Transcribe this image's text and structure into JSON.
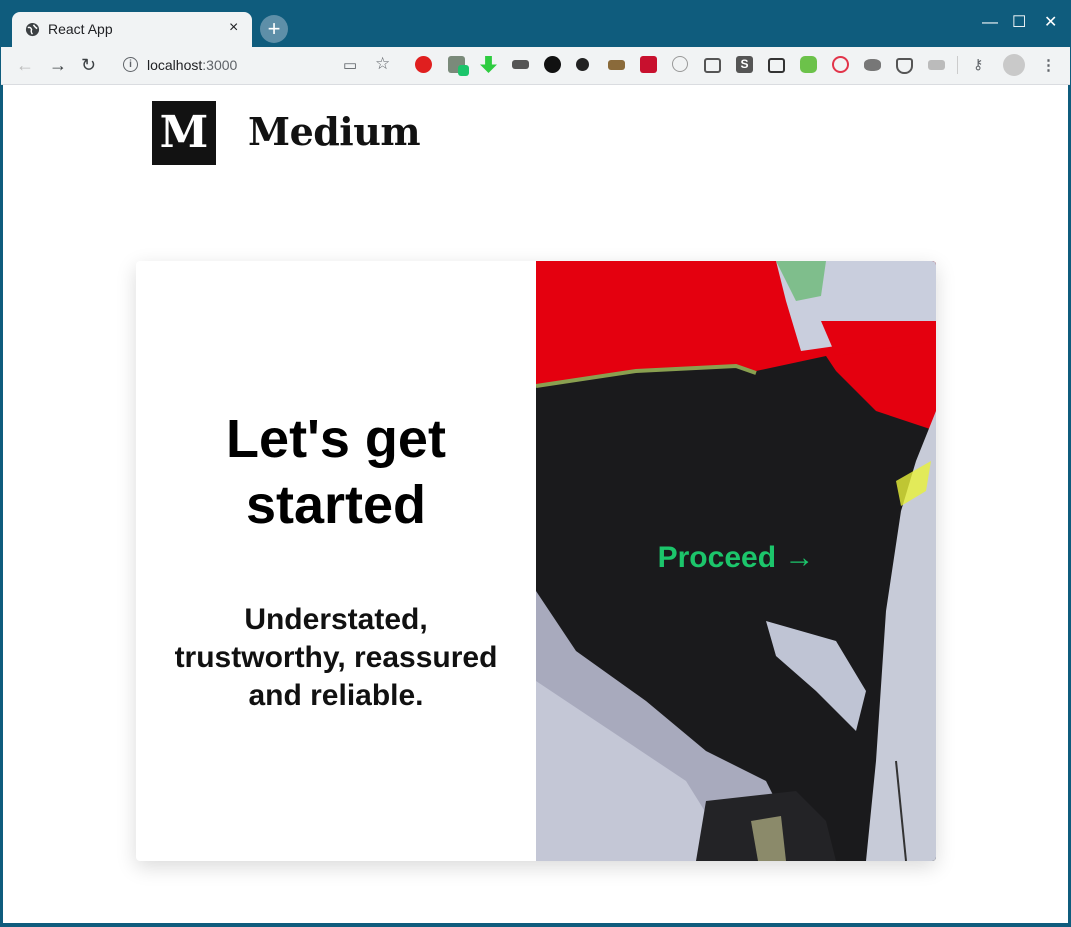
{
  "browser": {
    "tab_title": "React App",
    "tab_close": "×",
    "new_tab": "+",
    "url_host": "localhost",
    "url_port": ":3000",
    "window_controls": [
      "—",
      "☐",
      "✕"
    ]
  },
  "page": {
    "logo_letter": "M",
    "brand_name": "Medium",
    "headline": "Let's get started",
    "subheadline": "Understated, trustworthy, reassured and reliable.",
    "proceed_label": "Proceed →",
    "accent_color": "#1cc56b"
  }
}
